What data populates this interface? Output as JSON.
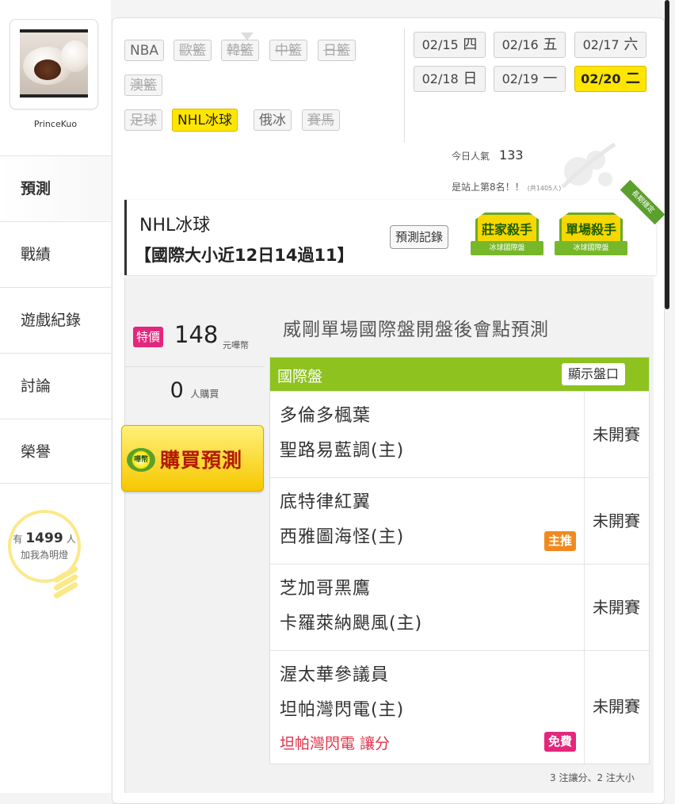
{
  "profile": {
    "username": "PrinceKuo"
  },
  "nav": [
    {
      "label": "預測",
      "active": true
    },
    {
      "label": "戰績"
    },
    {
      "label": "遊戲紀錄"
    },
    {
      "label": "討論"
    },
    {
      "label": "榮譽"
    }
  ],
  "fans": {
    "prefix": "有",
    "count": "1499",
    "suffix": "人",
    "line2": "加我為明燈"
  },
  "leagues": [
    {
      "label": "NBA"
    },
    {
      "label": "歐籃"
    },
    {
      "label": "韓籃"
    },
    {
      "label": "中籃"
    },
    {
      "label": "日籃"
    },
    {
      "label": "澳籃"
    },
    {
      "label": "足球"
    },
    {
      "label": "NHL冰球",
      "selected": true
    },
    {
      "label": "俄冰"
    },
    {
      "label": "賽馬"
    }
  ],
  "dates": [
    {
      "md": "02/15",
      "dow": "四"
    },
    {
      "md": "02/16",
      "dow": "五"
    },
    {
      "md": "02/17",
      "dow": "六"
    },
    {
      "md": "02/18",
      "dow": "日"
    },
    {
      "md": "02/19",
      "dow": "一"
    },
    {
      "md": "02/20",
      "dow": "二",
      "selected": true
    }
  ],
  "popularity": {
    "label": "今日人氣",
    "value": "133",
    "rank_text": "是站上第8名！！",
    "total": "(共1405人)"
  },
  "banner": {
    "title": "NHL冰球",
    "subtitle": "【國際大小近12日14過11】",
    "record_button": "預測記錄",
    "badges": [
      {
        "title": "莊家殺手",
        "ribbon": "冰球國際盤"
      },
      {
        "title": "單場殺手",
        "ribbon": "冰球國際盤"
      }
    ],
    "corner": "長期穩定"
  },
  "purchase": {
    "special_label": "特價",
    "price": "148",
    "price_unit": "元嘩幣",
    "buyers": "0",
    "buyers_unit": "人購買",
    "buy_button": "購買預測",
    "coin_text": "嘩幣"
  },
  "prediction_title": "威剛單場國際盤開盤後會點預測",
  "table": {
    "header": "國際盤",
    "show_button": "顯示盤口",
    "games": [
      {
        "away": "多倫多楓葉",
        "home": "聖路易藍調(主)",
        "status": "未開賽"
      },
      {
        "away": "底特律紅翼",
        "home": "西雅圖海怪(主)",
        "status": "未開賽",
        "pill": "主推"
      },
      {
        "away": "芝加哥黑鷹",
        "home": "卡羅萊納颶風(主)",
        "status": "未開賽"
      },
      {
        "away": "渥太華參議員",
        "home": "坦帕灣閃電(主)",
        "status": "未開賽",
        "handicap": "坦帕灣閃電 讓分",
        "pill": "免費"
      }
    ]
  },
  "footnote": "3 注讓分、2 注大小"
}
